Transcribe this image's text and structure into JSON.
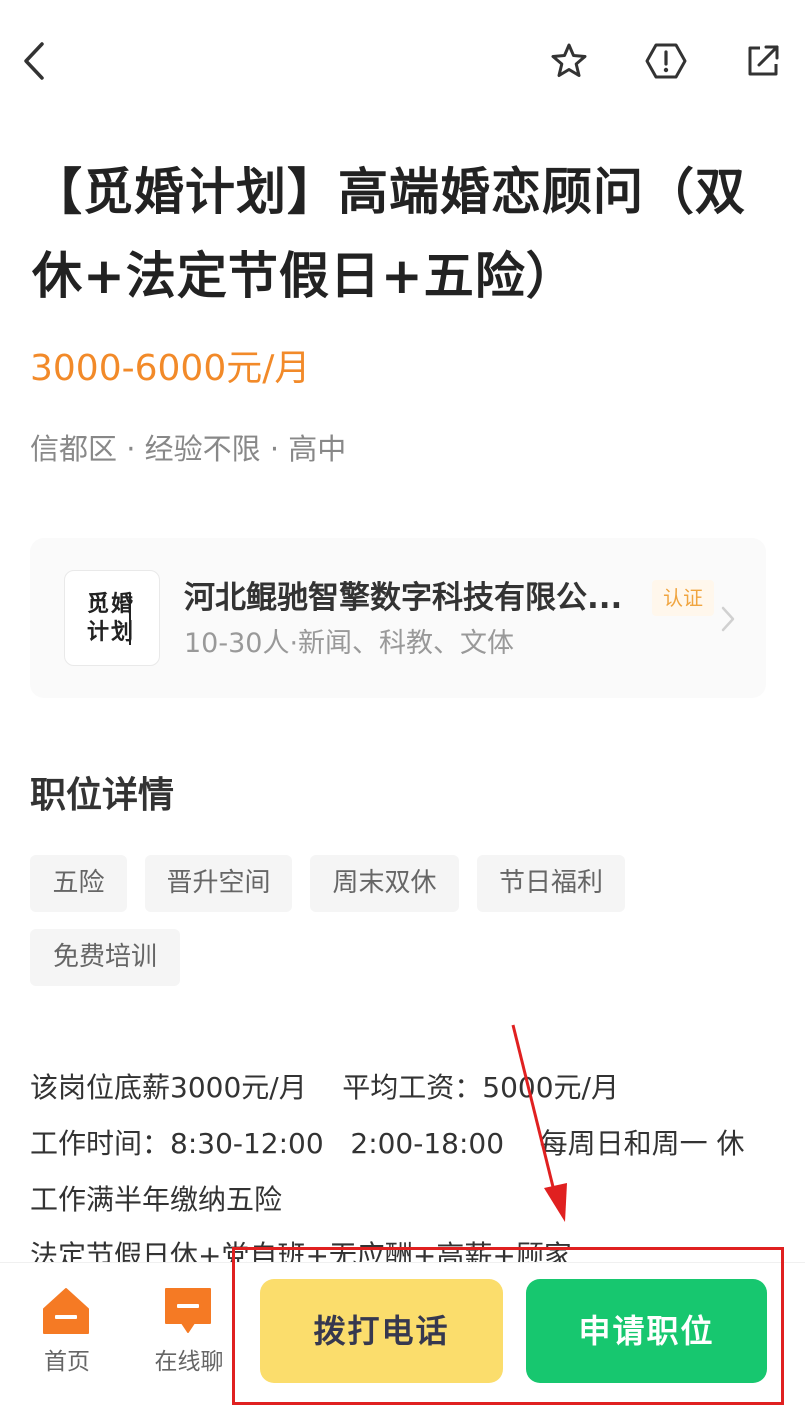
{
  "topbar": {
    "icons": [
      "back-icon",
      "star-icon",
      "report-icon",
      "share-icon"
    ]
  },
  "job": {
    "title": "【觅婚计划】高端婚恋顾问（双休+法定节假日+五险）",
    "salary": "3000-6000元/月",
    "meta": "信都区 · 经验不限 ·  高中"
  },
  "company": {
    "logo_text": "觅婚计划",
    "name": "河北鲲驰智擎数字科技有限公...",
    "cert_label": "认证",
    "desc": "10-30人·新闻、科教、文体"
  },
  "details": {
    "title": "职位详情",
    "tags": [
      "五险",
      "晋升空间",
      "周末双休",
      "节日福利",
      "免费培训"
    ],
    "description_lines": [
      "该岗位底薪3000元/月    平均工资：5000元/月",
      "工作时间：8:30-12:00   2:00-18:00    每周日和周一 休",
      "工作满半年缴纳五险",
      "法定节假日休+党自班+无应酬+高薪+顾家"
    ]
  },
  "bottom": {
    "nav": [
      {
        "label": "首页",
        "icon": "home-icon"
      },
      {
        "label": "在线聊",
        "icon": "chat-icon"
      }
    ],
    "call_label": "拨打电话",
    "apply_label": "申请职位"
  },
  "colors": {
    "salary": "#f28a29",
    "call_button": "#fbdd6c",
    "apply_button": "#17c76f",
    "nav_icon": "#f57a24",
    "annotation": "#e02020"
  }
}
